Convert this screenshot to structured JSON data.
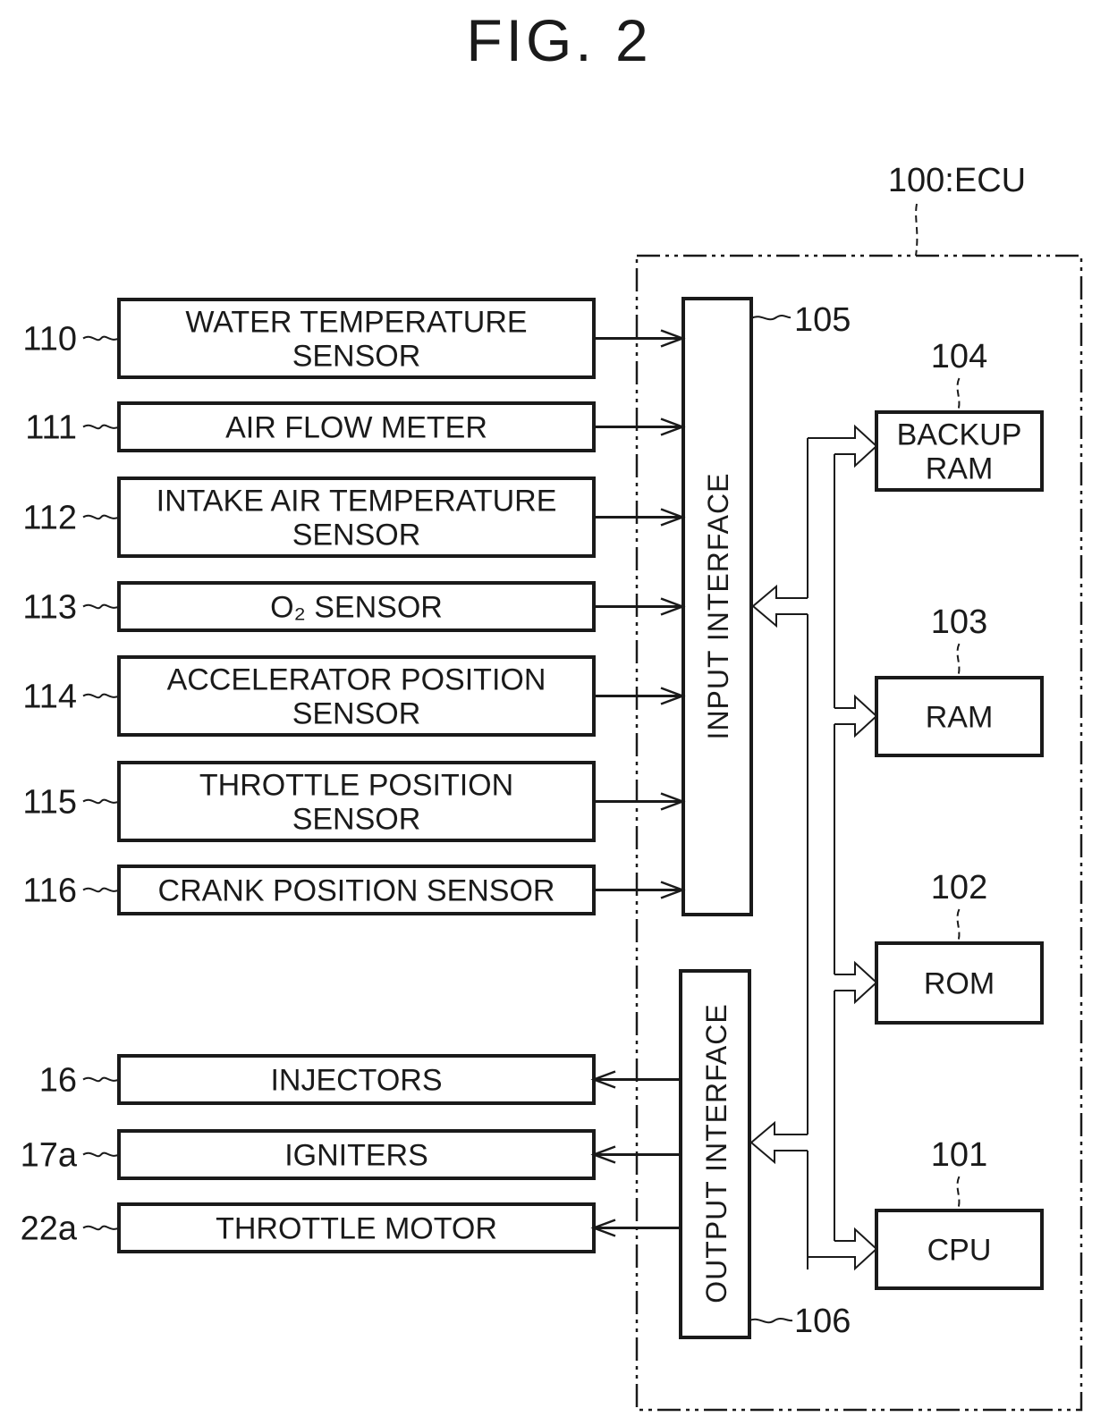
{
  "figure": {
    "title": "FIG. 2"
  },
  "ecu": {
    "ref": "100",
    "label": "100:ECU",
    "input_interface": {
      "ref": "105",
      "label": "INPUT INTERFACE"
    },
    "output_interface": {
      "ref": "106",
      "label": "OUTPUT INTERFACE"
    },
    "memory_blocks": [
      {
        "ref": "104",
        "lines": [
          "BACKUP",
          "RAM"
        ]
      },
      {
        "ref": "103",
        "lines": [
          "RAM"
        ]
      },
      {
        "ref": "102",
        "lines": [
          "ROM"
        ]
      },
      {
        "ref": "101",
        "lines": [
          "CPU"
        ]
      }
    ]
  },
  "sensors": [
    {
      "ref": "110",
      "lines": [
        "WATER TEMPERATURE",
        "SENSOR"
      ]
    },
    {
      "ref": "111",
      "lines": [
        "AIR FLOW METER"
      ]
    },
    {
      "ref": "112",
      "lines": [
        "INTAKE AIR TEMPERATURE",
        "SENSOR"
      ]
    },
    {
      "ref": "113",
      "lines": [
        "O₂ SENSOR"
      ]
    },
    {
      "ref": "114",
      "lines": [
        "ACCELERATOR POSITION",
        "SENSOR"
      ]
    },
    {
      "ref": "115",
      "lines": [
        "THROTTLE POSITION",
        "SENSOR"
      ]
    },
    {
      "ref": "116",
      "lines": [
        "CRANK POSITION SENSOR"
      ]
    }
  ],
  "actuators": [
    {
      "ref": "16",
      "lines": [
        "INJECTORS"
      ]
    },
    {
      "ref": "17a",
      "lines": [
        "IGNITERS"
      ]
    },
    {
      "ref": "22a",
      "lines": [
        "THROTTLE MOTOR"
      ]
    }
  ],
  "connections": {
    "sensors_to": "input_interface",
    "output_interface_to": "actuators",
    "bus_links": [
      "input_interface",
      "output_interface",
      "104",
      "103",
      "102",
      "101"
    ]
  }
}
